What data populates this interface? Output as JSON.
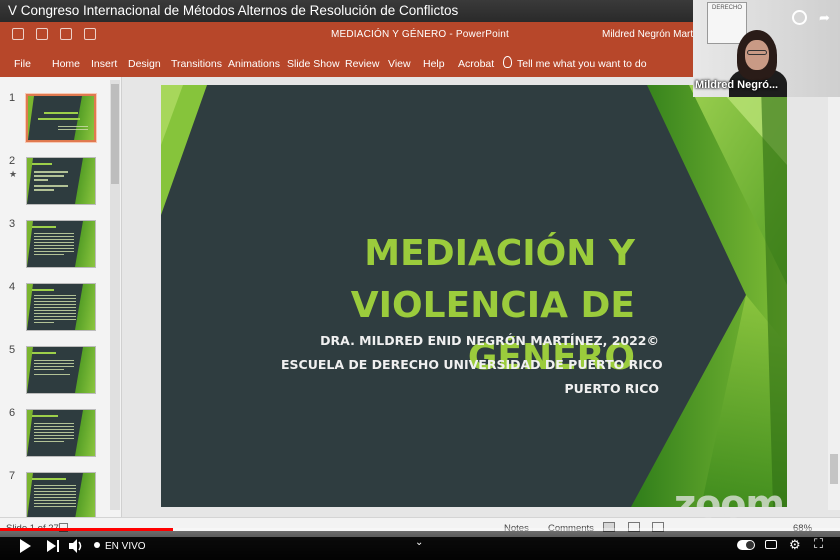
{
  "video": {
    "title": "V Congreso Internacional de Métodos Alternos de Resolución de Conflictos",
    "progress_fraction": 0.206,
    "live_label": "EN VIVO"
  },
  "powerpoint": {
    "window_title": "MEDIACIÓN Y GÉNERO  -  PowerPoint",
    "user_name": "Mildred Negrón Martín",
    "ribbon_tabs": [
      "File",
      "Home",
      "Insert",
      "Design",
      "Transitions",
      "Animations",
      "Slide Show",
      "Review",
      "View",
      "Help",
      "Acrobat"
    ],
    "tell_me": "Tell me what you want to do",
    "thumbnails": [
      {
        "num": "1",
        "star": ""
      },
      {
        "num": "2",
        "star": "★"
      },
      {
        "num": "3",
        "star": ""
      },
      {
        "num": "4",
        "star": ""
      },
      {
        "num": "5",
        "star": ""
      },
      {
        "num": "6",
        "star": ""
      },
      {
        "num": "7",
        "star": ""
      }
    ],
    "slide": {
      "title_line1": "MEDIACIÓN Y",
      "title_line2": "VIOLENCIA DE GÉNERO",
      "author": "DRA. MILDRED ENID NEGRÓN MARTÍNEZ, 2022©",
      "school": "ESCUELA DE DERECHO UNIVERSIDAD DE PUERTO RICO",
      "place": "PUERTO RICO"
    },
    "status": {
      "slide_count": "Slide 1 of 27",
      "notes": "Notes",
      "comments": "Comments",
      "zoom_level": "68%"
    }
  },
  "participant": {
    "name": "Mildred Negró...",
    "poster_text": "DERECHO"
  },
  "watermark": "zoom",
  "colors": {
    "ppt_accent": "#b7472a",
    "slide_bg": "#2f3d40",
    "slide_title": "#9bcc3c",
    "progress": "#ff0000"
  }
}
